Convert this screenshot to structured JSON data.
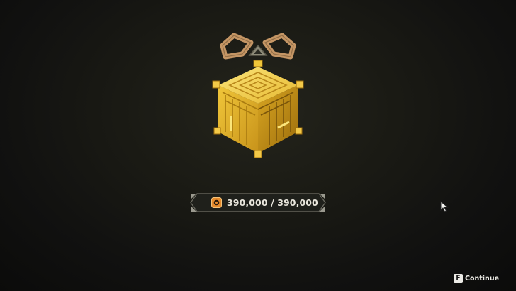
{
  "reward": {
    "icon": "golden-cube-gift-icon",
    "counter_icon": "currency-token-icon",
    "counter_text": "390,000 / 390,000"
  },
  "prompt": {
    "key": "F",
    "label": "Continue"
  },
  "colors": {
    "gold": "#e0b52a",
    "gold_dark": "#a97b10",
    "gold_light": "#f6d95c",
    "ribbon": "#c59665",
    "plate": "#1f201b",
    "text": "#e9e6dc"
  }
}
